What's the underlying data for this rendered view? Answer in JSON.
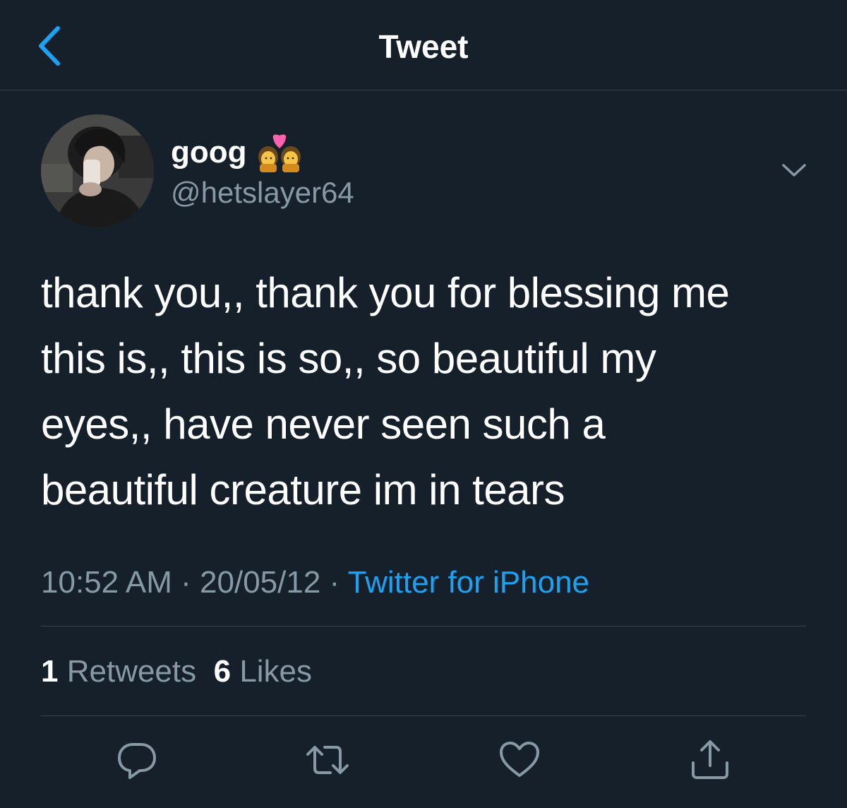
{
  "header": {
    "title": "Tweet",
    "back_icon": "chevron-left-icon",
    "accent": "#1da1f2"
  },
  "tweet": {
    "display_name": "goog",
    "name_emoji": "couple-with-heart-woman-woman-emoji",
    "handle": "@hetslayer64",
    "text": "thank you,, thank you for blessing me\nthis is,, this is so,, so beautiful my\neyes,, have never seen such a\nbeautiful creature im in tears",
    "time": "10:52 AM",
    "separator": "·",
    "date": "20/05/12",
    "source": "Twitter for iPhone"
  },
  "stats": {
    "retweets_count": "1",
    "retweets_label": "Retweets",
    "likes_count": "6",
    "likes_label": "Likes"
  },
  "actions": {
    "reply_icon": "reply-icon",
    "retweet_icon": "retweet-icon",
    "like_icon": "heart-icon",
    "share_icon": "share-icon"
  },
  "colors": {
    "background": "#15202b",
    "secondary_text": "#8899a6",
    "divider": "#38444d",
    "link": "#1da1f2"
  }
}
